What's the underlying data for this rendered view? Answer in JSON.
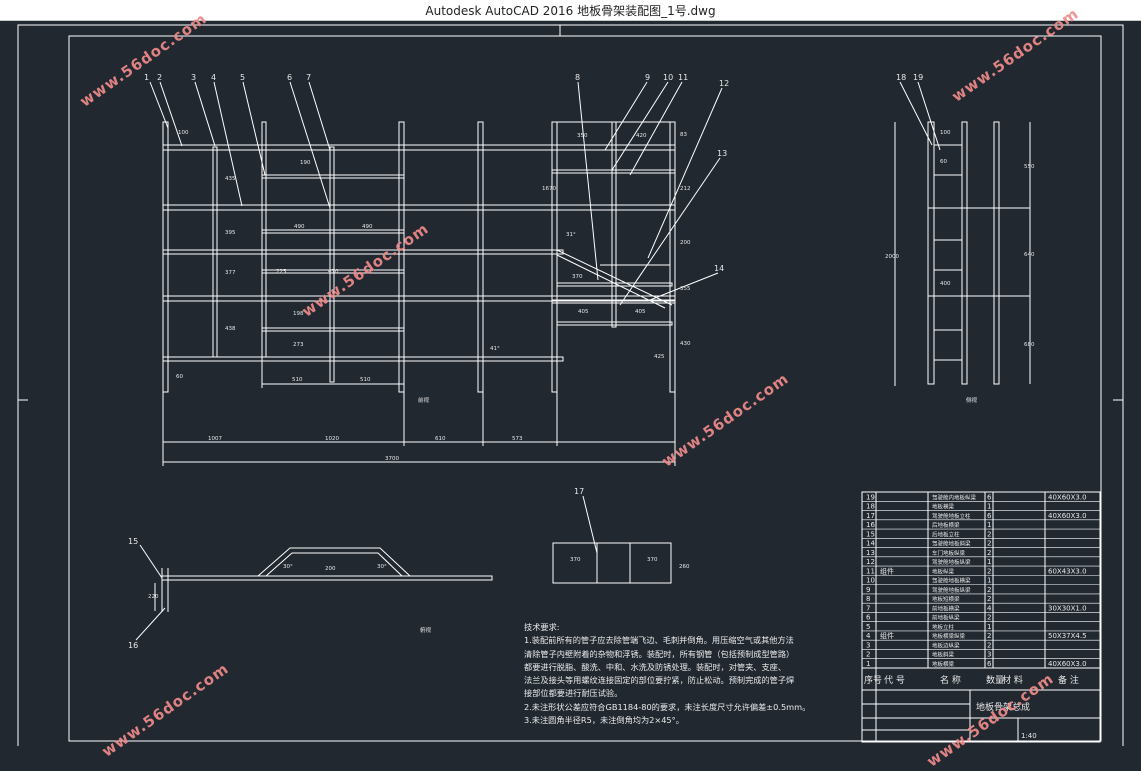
{
  "window": {
    "title": "Autodesk AutoCAD 2016     地板骨架装配图_1号.dwg"
  },
  "colors": {
    "background": "#212830",
    "lines": "#ffffff",
    "watermark": "#f08a8a"
  },
  "watermark": "www.56doc.com",
  "front_view": {
    "callouts": [
      "1",
      "2",
      "3",
      "4",
      "5",
      "6",
      "7",
      "8",
      "9",
      "10",
      "11",
      "12",
      "13",
      "14"
    ],
    "dims": {
      "top_1": "100",
      "top_2": "350",
      "top_3": "420",
      "v_435": "435",
      "v_395": "395",
      "v_377": "377",
      "v_438": "438",
      "v_190": "190",
      "v_212": "212",
      "w_490a": "490",
      "w_490b": "490",
      "w_225": "225",
      "w_470": "470",
      "v_198": "198",
      "v_273": "273",
      "w_510a": "510",
      "w_510b": "510",
      "v_60": "60",
      "v_83": "83",
      "v_200": "200",
      "v_355": "355",
      "w_370": "370",
      "w_405a": "405",
      "w_405b": "405",
      "v_425": "425",
      "v_430": "430",
      "v_1670": "1670",
      "angle_31": "31°",
      "angle_41": "41°",
      "bottom_1": "1007",
      "bottom_2": "1020",
      "bottom_3": "610",
      "bottom_4": "573",
      "overall": "3700",
      "section_label": "前视"
    }
  },
  "side_view": {
    "callouts": [
      "18",
      "19"
    ],
    "dims": {
      "v_2000": "2000",
      "v_550": "550",
      "v_640": "640",
      "v_680": "680",
      "v_100": "100",
      "v_60": "60",
      "v_400": "400",
      "label": "侧视"
    }
  },
  "bottom_view": {
    "callouts": [
      "15",
      "16",
      "17"
    ],
    "dims": {
      "v_220": "220",
      "h_200": "200",
      "a_30a": "30°",
      "a_30b": "30°",
      "w_370a": "370",
      "w_370b": "370",
      "h_260": "260",
      "label": "俯视"
    }
  },
  "tech_requirements": {
    "heading": "技术要求:",
    "lines": [
      "1.装配前所有的管子应去除管端飞边、毛刺并倒角。用压缩空气或其他方法",
      "清除管子内壁附着的杂物和浮锈。装配时，所有钢管（包括预制成型管路）",
      "都要进行脱脂、酸洗、中和、水洗及防锈处理。装配时，对管夹、支座、",
      "法兰及接头等用螺纹连接固定的部位要拧紧，防止松动。预制完成的管子焊",
      "接部位都要进行耐压试验。",
      "2.未注形状公差应符合GB1184-80的要求，未注长度尺寸允许偏差±0.5mm。",
      "3.未注圆角半径R5，未注倒角均为2×45°。"
    ]
  },
  "parts_list": {
    "rows": [
      {
        "no": "19",
        "code": "",
        "name": "驾驶舱内地板纵梁",
        "qty": "6",
        "mat": "",
        "note": "40X60X3.0"
      },
      {
        "no": "18",
        "code": "",
        "name": "地板横梁",
        "qty": "1",
        "mat": "",
        "note": ""
      },
      {
        "no": "17",
        "code": "",
        "name": "驾驶舱地板立柱",
        "qty": "6",
        "mat": "",
        "note": "40X60X3.0"
      },
      {
        "no": "16",
        "code": "",
        "name": "后地板横梁",
        "qty": "1",
        "mat": "",
        "note": ""
      },
      {
        "no": "15",
        "code": "",
        "name": "后地板立柱",
        "qty": "2",
        "mat": "",
        "note": ""
      },
      {
        "no": "14",
        "code": "",
        "name": "驾驶舱地板斜梁",
        "qty": "2",
        "mat": "",
        "note": ""
      },
      {
        "no": "13",
        "code": "",
        "name": "车门地板纵梁",
        "qty": "2",
        "mat": "",
        "note": ""
      },
      {
        "no": "12",
        "code": "",
        "name": "驾驶舱地板纵梁",
        "qty": "1",
        "mat": "",
        "note": ""
      },
      {
        "no": "11",
        "code": "组件",
        "name": "地板纵梁",
        "qty": "2",
        "mat": "",
        "note": "60X43X3.0"
      },
      {
        "no": "10",
        "code": "",
        "name": "驾驶舱地板横梁",
        "qty": "1",
        "mat": "",
        "note": ""
      },
      {
        "no": "9",
        "code": "",
        "name": "驾驶舱地板纵梁",
        "qty": "2",
        "mat": "",
        "note": ""
      },
      {
        "no": "8",
        "code": "",
        "name": "地板短横梁",
        "qty": "2",
        "mat": "",
        "note": ""
      },
      {
        "no": "7",
        "code": "",
        "name": "前地板横梁",
        "qty": "4",
        "mat": "",
        "note": "30X30X1.0"
      },
      {
        "no": "6",
        "code": "",
        "name": "前地板纵梁",
        "qty": "2",
        "mat": "",
        "note": ""
      },
      {
        "no": "5",
        "code": "",
        "name": "地板立柱",
        "qty": "1",
        "mat": "",
        "note": ""
      },
      {
        "no": "4",
        "code": "组件",
        "name": "地板横梁纵梁",
        "qty": "2",
        "mat": "",
        "note": "50X37X4.5"
      },
      {
        "no": "3",
        "code": "",
        "name": "地板边纵梁",
        "qty": "2",
        "mat": "",
        "note": ""
      },
      {
        "no": "2",
        "code": "",
        "name": "地板斜梁",
        "qty": "3",
        "mat": "",
        "note": ""
      },
      {
        "no": "1",
        "code": "",
        "name": "地板横梁",
        "qty": "6",
        "mat": "",
        "note": "40X60X3.0"
      }
    ],
    "header": {
      "no": "序号",
      "code": "代 号",
      "name": "名 称",
      "qty": "数量",
      "mat": "材 料",
      "note": "备 注"
    },
    "title_block": {
      "drawing_name": "地板骨架总成",
      "scale": "1:40"
    }
  }
}
